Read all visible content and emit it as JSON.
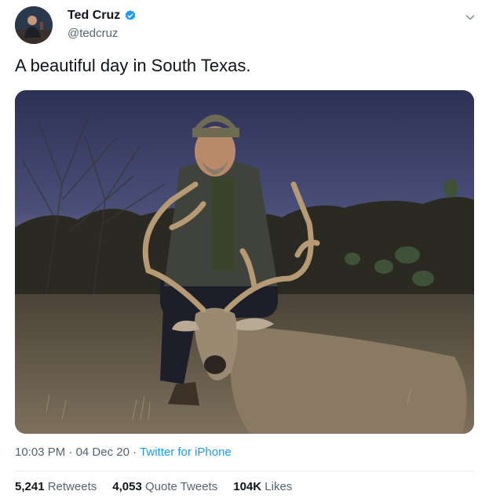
{
  "author": {
    "display_name": "Ted Cruz",
    "handle": "@tedcruz",
    "verified": true
  },
  "tweet": {
    "text": "A beautiful day in South Texas."
  },
  "meta": {
    "time": "10:03 PM",
    "separator": "·",
    "date": "04 Dec 20",
    "source": "Twitter for iPhone"
  },
  "stats": {
    "retweets_count": "5,241",
    "retweets_label": "Retweets",
    "quotes_count": "4,053",
    "quotes_label": "Quote Tweets",
    "likes_count": "104K",
    "likes_label": "Likes"
  },
  "colors": {
    "link_blue": "#1d9bf0",
    "secondary_text": "#536471",
    "primary_text": "#0f1419"
  },
  "icons": {
    "verified": "verified-badge-icon",
    "caret": "chevron-down-icon"
  }
}
